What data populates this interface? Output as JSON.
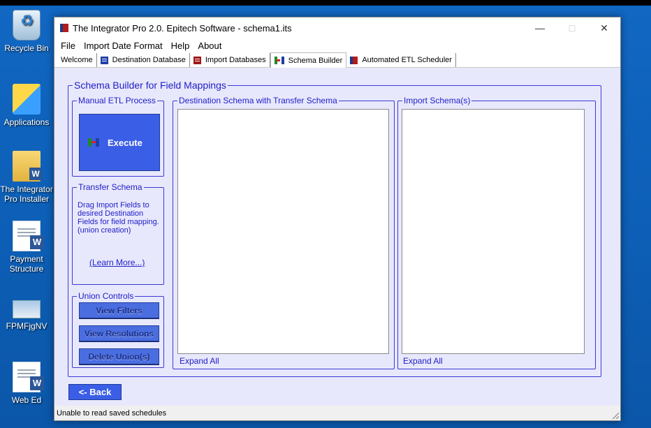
{
  "desktop": {
    "icons": [
      {
        "label": "Recycle Bin",
        "icon": "recycle-bin-icon"
      },
      {
        "label": "Applications",
        "icon": "application-icon"
      },
      {
        "label": "The Integrator Pro Installer",
        "icon": "folder-icon"
      },
      {
        "label": "Payment Structure",
        "icon": "word-document-icon"
      },
      {
        "label": "FPMFjgNV",
        "icon": "image-file-icon"
      },
      {
        "label": "Web Ed",
        "icon": "word-document-icon"
      }
    ]
  },
  "window": {
    "title": "The Integrator Pro 2.0. Epitech Software - schema1.its",
    "controls": {
      "minimize": "—",
      "maximize": "□",
      "close": "✕"
    }
  },
  "menu": [
    "File",
    "Import Date Format",
    "Help",
    "About"
  ],
  "tabs": [
    {
      "label": "Welcome",
      "icon": ""
    },
    {
      "label": "Destination Database",
      "icon": "database-blue-icon"
    },
    {
      "label": "Import Databases",
      "icon": "database-red-icon"
    },
    {
      "label": "Schema Builder",
      "icon": "schema-icon",
      "active": true
    },
    {
      "label": "Automated ETL Scheduler",
      "icon": "scheduler-icon"
    }
  ],
  "schema_builder": {
    "title": "Schema Builder for Field Mappings",
    "manual_etl": {
      "title": "Manual ETL Process",
      "execute_label": "Execute"
    },
    "transfer_schema": {
      "title": "Transfer Schema",
      "description": "Drag Import Fields to desired Destination Fields for field mapping. (union creation)",
      "learn_more": "(Learn More...)"
    },
    "union_controls": {
      "title": "Union Controls",
      "view_filters": "View Filters",
      "view_resolutions": "View Resolutions",
      "delete_unions": "Delete Union(s)"
    },
    "destination": {
      "title": "Destination Schema with Transfer Schema",
      "expand_all": "Expand All"
    },
    "import": {
      "title": "Import Schema(s)",
      "expand_all": "Expand All"
    },
    "back_label": "<- Back"
  },
  "status": "Unable to read saved schedules",
  "colors": {
    "accent": "#3b5ee6",
    "panel_bg": "#e8e8fc",
    "label_blue": "#2020c8",
    "desktop_blue": "#1167c2"
  }
}
